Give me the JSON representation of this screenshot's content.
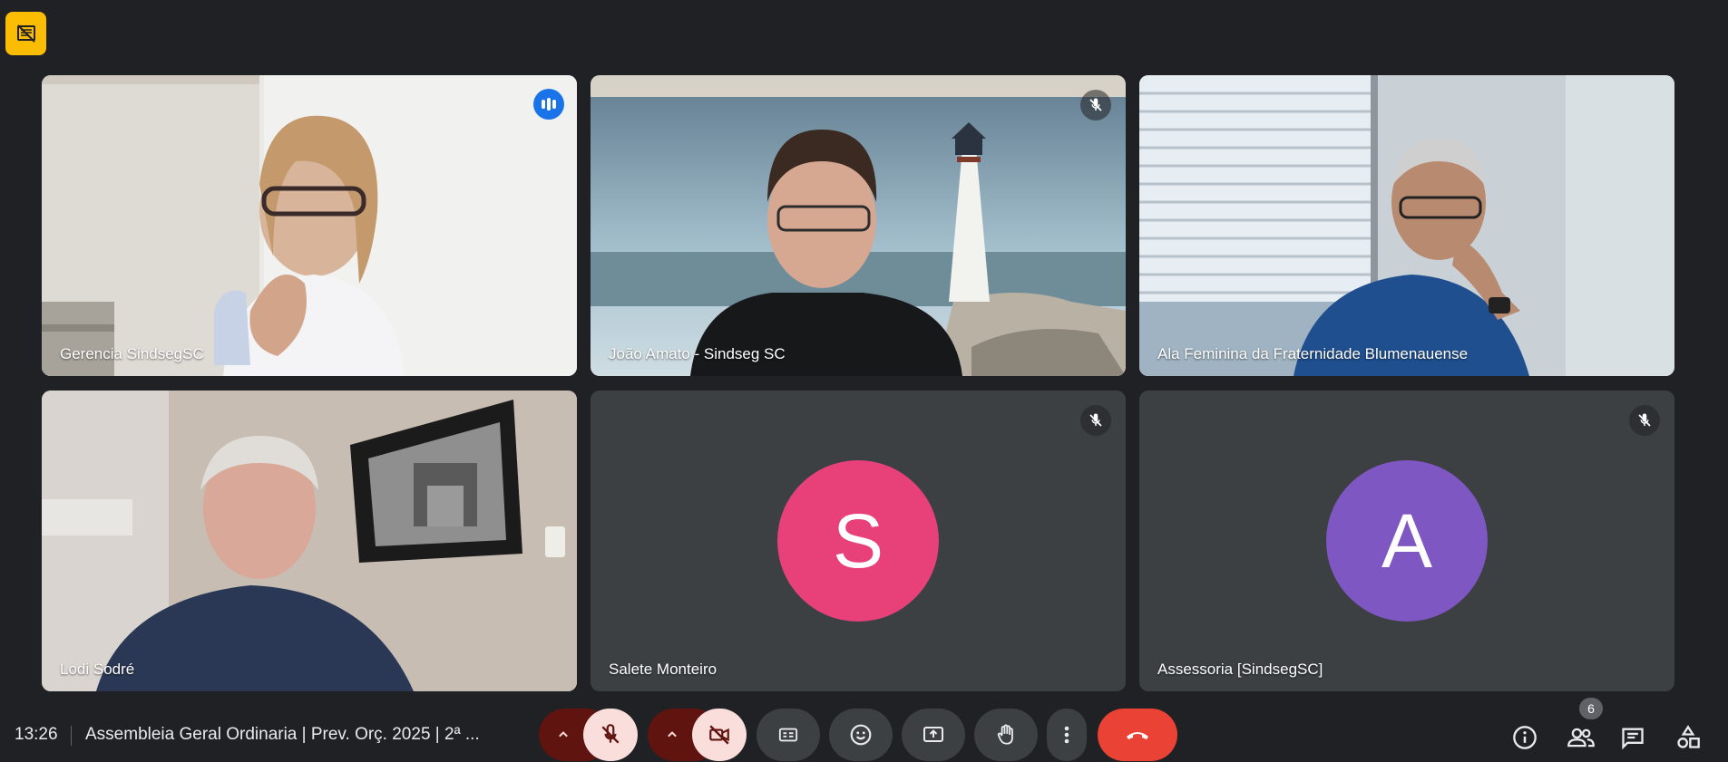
{
  "participants": [
    {
      "name": "Gerencia SindsegSC",
      "state": "speaking"
    },
    {
      "name": "João Amato - Sindseg SC",
      "state": "muted"
    },
    {
      "name": "Ala Feminina da Fraternidade Blumenauense",
      "state": "active"
    },
    {
      "name": "Lodi Sodré",
      "state": "active"
    },
    {
      "name": "Salete Monteiro",
      "state": "muted",
      "avatar_letter": "S",
      "avatar_color": "#e8417a"
    },
    {
      "name": "Assessoria [SindsegSC]",
      "state": "muted",
      "avatar_letter": "A",
      "avatar_color": "#7e57c2"
    }
  ],
  "bottom_bar": {
    "time": "13:26",
    "meeting_title": "Assembleia Geral Ordinaria | Prev. Orç. 2025 | 2ª ...",
    "participant_count": "6",
    "controls": [
      {
        "name": "audio-options",
        "icon": "chevron-up-icon"
      },
      {
        "name": "microphone-off",
        "icon": "mic-off-icon"
      },
      {
        "name": "video-options",
        "icon": "chevron-up-icon"
      },
      {
        "name": "camera-off",
        "icon": "camera-off-icon"
      },
      {
        "name": "captions",
        "icon": "captions-icon"
      },
      {
        "name": "reactions",
        "icon": "emoji-icon"
      },
      {
        "name": "present",
        "icon": "present-screen-icon"
      },
      {
        "name": "raise-hand",
        "icon": "hand-icon"
      },
      {
        "name": "more-options",
        "icon": "more-vert-icon"
      },
      {
        "name": "leave-call",
        "icon": "call-end-icon"
      }
    ],
    "right_icons": [
      "info-icon",
      "people-icon",
      "chat-icon",
      "activities-icon"
    ]
  },
  "colors": {
    "background": "#202124",
    "speaking_border": "#8ab4f8",
    "hangup": "#ea4335",
    "recording_indicator": "#fbbc04"
  }
}
